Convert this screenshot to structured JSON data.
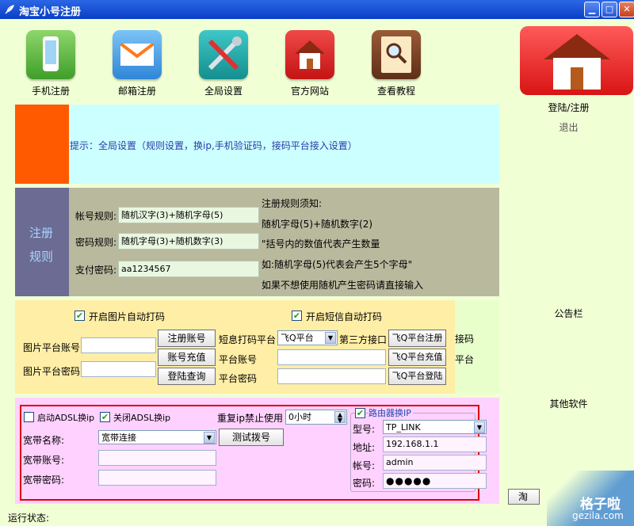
{
  "window": {
    "title": "淘宝小号注册"
  },
  "toolbar": {
    "items": [
      {
        "label": "手机注册",
        "icon": "phone-icon"
      },
      {
        "label": "邮箱注册",
        "icon": "mail-icon"
      },
      {
        "label": "全局设置",
        "icon": "tools-icon"
      },
      {
        "label": "官方网站",
        "icon": "house-icon"
      },
      {
        "label": "查看教程",
        "icon": "book-icon"
      }
    ]
  },
  "side": {
    "login_label": "登陆/注册",
    "logout_label": "退出",
    "notice_label": "公告栏",
    "other_label": "其他软件",
    "partial_btn": "淘"
  },
  "tip": {
    "text": "提示：全局设置（规则设置，换ip,手机验证码，接码平台接入设置）"
  },
  "rules": {
    "side_title_1": "注册",
    "side_title_2": "规则",
    "account_label": "帐号规则:",
    "account_value": "随机汉字(3)+随机字母(5)",
    "password_label": "密码规则:",
    "password_value": "随机字母(3)+随机数字(3)",
    "pay_label": "支付密码:",
    "pay_value": "aa1234567",
    "notes": [
      "注册规则须知:",
      "随机字母(5)+随机数字(2)",
      "\"括号内的数值代表产生数量",
      "如:随机字母(5)代表会产生5个字母\"",
      "如果不想使用随机产生密码请直接输入"
    ]
  },
  "captcha": {
    "img_check_label": "开启图片自动打码",
    "sms_check_label": "开启短信自动打码",
    "img_account_label": "图片平台账号",
    "img_password_label": "图片平台密码",
    "btn_register": "注册账号",
    "btn_recharge": "账号充值",
    "btn_query": "登陆查询",
    "sms_platform_label": "短息打码平台",
    "sms_platform_value": "飞Q平台",
    "third_party_label": "第三方接口",
    "platform_account_label": "平台账号",
    "platform_password_label": "平台密码",
    "fq_register": "飞Q平台注册",
    "fq_recharge": "飞Q平台充值",
    "fq_login": "飞Q平台登陆",
    "side_label_1": "接码",
    "side_label_2": "平台"
  },
  "network": {
    "adsl_on_label": "启动ADSL换ip",
    "adsl_off_label": "关闭ADSL换ip",
    "repeat_label": "重复ip禁止使用",
    "repeat_value": "0小时",
    "broadband_name_label": "宽带名称:",
    "broadband_name_value": "宽带连接",
    "test_dial_btn": "测试拨号",
    "broadband_account_label": "宽带账号:",
    "broadband_password_label": "宽带密码:",
    "router_label": "路由器换IP",
    "model_label": "型号:",
    "model_value": "TP_LINK",
    "address_label": "地址:",
    "address_value": "192.168.1.1",
    "account_label": "帐号:",
    "account_value": "admin",
    "password_label": "密码:",
    "password_value": "●●●●●"
  },
  "status": {
    "label": "运行状态:"
  },
  "watermark": {
    "text1": "格子啦",
    "text2": "gezila.com"
  },
  "colors": {
    "background": "#f1ffd5",
    "titlebar": "#0a3fc6",
    "tip_panel": "#ccffff",
    "tip_accent": "#ff5a00",
    "rules_panel": "#b9b99e",
    "rules_side": "#6b6b94",
    "captcha_panel": "#ffeea6",
    "network_panel": "#ffd1ff",
    "highlight_border": "#e00000"
  }
}
